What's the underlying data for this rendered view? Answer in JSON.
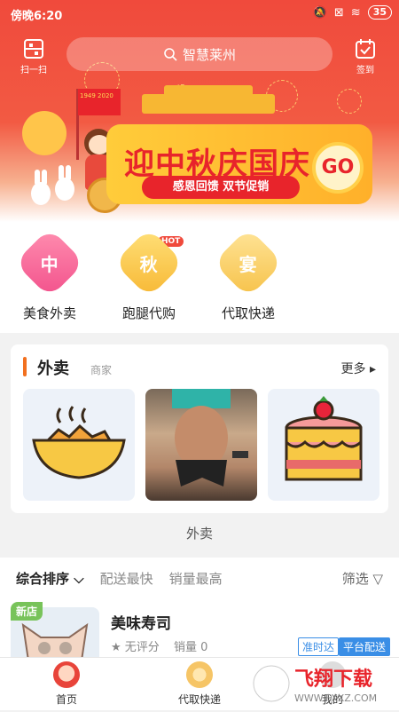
{
  "status_bar": {
    "time": "傍晚6:20",
    "battery": "35"
  },
  "header": {
    "scan_label": "扫一扫",
    "search_placeholder": "智慧莱州",
    "signin_label": "签到"
  },
  "banner": {
    "flag_text": "1949 2020",
    "title": "迎中秋庆国庆",
    "subtitle": "感恩回馈 双节促销",
    "go_label": "GO"
  },
  "categories": [
    {
      "icon_char": "中",
      "label": "美食外卖",
      "hot": ""
    },
    {
      "icon_char": "秋",
      "label": "跑腿代购",
      "hot": "HOT"
    },
    {
      "icon_char": "宴",
      "label": "代取快递",
      "hot": ""
    }
  ],
  "takeout_card": {
    "title": "外卖",
    "subtitle": "商家",
    "more_label": "更多 ▸"
  },
  "section_label": "外卖",
  "sort_options": [
    "综合排序 ⌵",
    "配送最快",
    "销量最高"
  ],
  "filter_label": "筛选 ▽",
  "shop": {
    "new_tag": "新店",
    "name": "美味寿司",
    "rating": "★ 无评分",
    "sales": "销量 0",
    "badges": [
      "准时达",
      "平台配送"
    ]
  },
  "tabbar": [
    {
      "label": "首页"
    },
    {
      "label": "代取快递"
    },
    {
      "label": "我的"
    }
  ],
  "watermark_text": "飞翔下载",
  "watermark_url": "WWW.FXXZ.COM"
}
